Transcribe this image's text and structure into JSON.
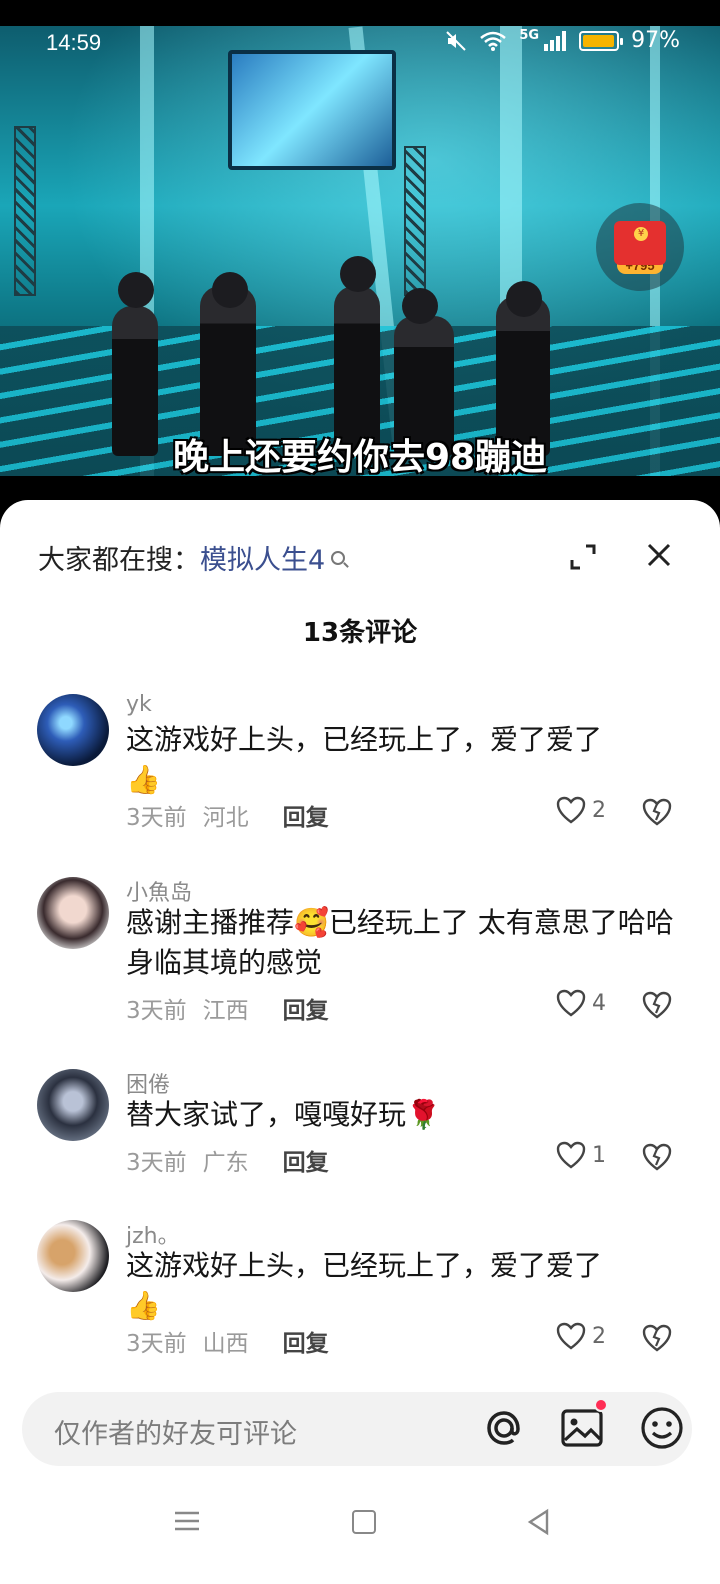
{
  "status_bar": {
    "time": "14:59",
    "network": "5G",
    "battery": "97%",
    "battery_level": 0.97
  },
  "video": {
    "subtitle": "晚上还要约你去98蹦迪",
    "reward_badge": "+795"
  },
  "sheet": {
    "search_prefix": "大家都在搜：",
    "search_term": "模拟人生4",
    "comment_count_title": "13条评论"
  },
  "comments": [
    {
      "user": "yk",
      "text": "这游戏好上头，已经玩上了，爱了爱了",
      "emoji": "👍",
      "time": "3天前",
      "location": "河北",
      "reply": "回复",
      "likes": "2"
    },
    {
      "user": "小魚岛",
      "text": "感谢主播推荐🥰已经玩上了 太有意思了哈哈 身临其境的感觉",
      "time": "3天前",
      "location": "江西",
      "reply": "回复",
      "likes": "4"
    },
    {
      "user": "困倦",
      "text": "替大家试了，嘎嘎好玩🌹",
      "time": "3天前",
      "location": "广东",
      "reply": "回复",
      "likes": "1"
    },
    {
      "user": "jzh。",
      "text": "这游戏好上头，已经玩上了，爱了爱了",
      "emoji": "👍",
      "time": "3天前",
      "location": "山西",
      "reply": "回复",
      "likes": "2"
    }
  ],
  "input": {
    "placeholder": "仅作者的好友可评论"
  },
  "colors": {
    "accent": "#3b4f8f",
    "notification_dot": "#ff2d55",
    "battery": "#f5b400"
  }
}
